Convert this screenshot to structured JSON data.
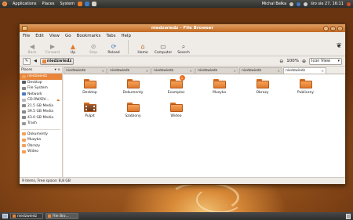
{
  "top_panel": {
    "menus": [
      "Applications",
      "Places",
      "System"
    ],
    "user": "Michal Bełka",
    "datetime": "śro sie 27, 16:11"
  },
  "window": {
    "title": "niedzwiedz - File Browser",
    "menubar": [
      "File",
      "Edit",
      "View",
      "Go",
      "Bookmarks",
      "Tabs",
      "Help"
    ],
    "toolbar": {
      "back": "Back",
      "forward": "Forward",
      "up": "Up",
      "stop": "Stop",
      "reload": "Reload",
      "home": "Home",
      "computer": "Computer",
      "search": "Search"
    },
    "location": {
      "crumb": "niedzwiedz",
      "zoom": "100%",
      "view": "Icon View"
    },
    "tabs": [
      "niedzwiedz",
      "niedzwiedz",
      "niedzwiedz",
      "niedzwiedz",
      "niedzwiedz",
      "niedzwiedz"
    ],
    "sidebar": {
      "header": "Places",
      "places": [
        "niedzwiedz",
        "Desktop",
        "File System",
        "Network",
        "CD-RW/DV...",
        "21.5 GB Media",
        "39.5 GB Media",
        "43.0 GB Media",
        "Trash"
      ],
      "bookmarks": [
        "Dokumenty",
        "Muzyka",
        "Obrazy",
        "Wideo"
      ]
    },
    "files": [
      "Desktop",
      "Dokumenty",
      "Examples",
      "Muzyka",
      "Obrazy",
      "Publiczny",
      "Pulpit",
      "Szablony",
      "Wideo"
    ],
    "status": "9 items, Free space: 8,8 GB"
  },
  "bottom_panel": {
    "tasks": [
      "niedzwiedz",
      "File Bro..."
    ]
  }
}
